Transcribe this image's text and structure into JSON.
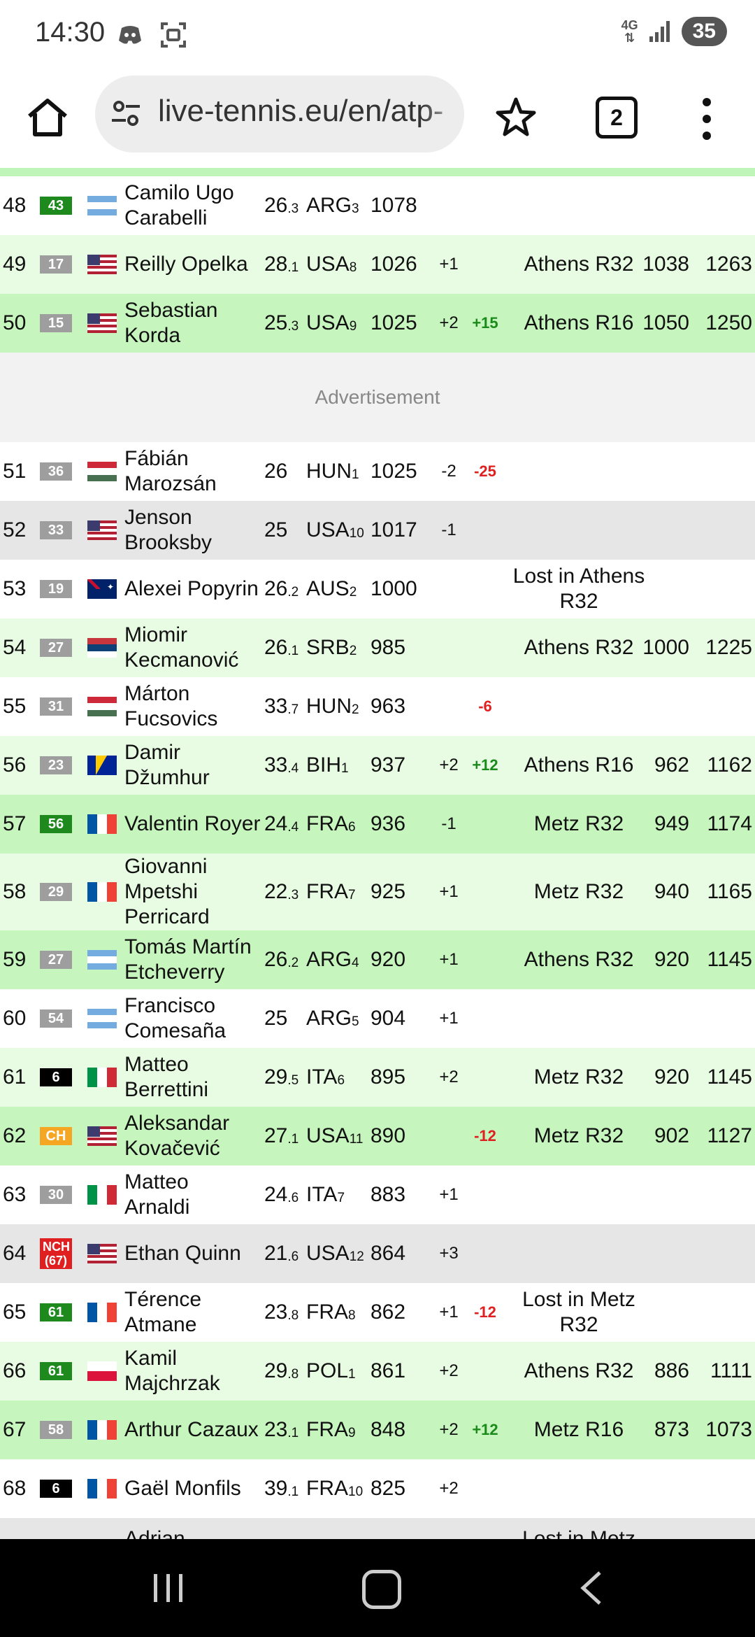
{
  "status_bar": {
    "time": "14:30",
    "left_icons": [
      "discord-icon",
      "screenshot-icon"
    ],
    "network": "4G",
    "battery": "35"
  },
  "browser": {
    "url": "live-tennis.eu/en/atp-",
    "tab_count": "2"
  },
  "ad_label": "Advertisement",
  "rows": [
    {
      "rank": "48",
      "prev": "43",
      "prev_color": "#1e8a1e",
      "flag": "ARG",
      "name": [
        "Camilo Ugo",
        "Carabelli"
      ],
      "age": "26",
      "age_sub": ".3",
      "country": "ARG",
      "country_sub": "3",
      "points": "1078",
      "diff": "",
      "change": "",
      "change_sign": "",
      "tournament": [],
      "max": "",
      "best2": "",
      "bg": "#ffffff"
    },
    {
      "rank": "49",
      "prev": "17",
      "prev_color": "#9e9e9e",
      "flag": "USA",
      "name": [
        "Reilly Opelka"
      ],
      "age": "28",
      "age_sub": ".1",
      "country": "USA",
      "country_sub": "8",
      "points": "1026",
      "diff": "+1",
      "change": "",
      "change_sign": "",
      "tournament": [
        "Athens R32"
      ],
      "max": "1038",
      "best2": "1263",
      "bg": "#e8fbe3"
    },
    {
      "rank": "50",
      "prev": "15",
      "prev_color": "#9e9e9e",
      "flag": "USA",
      "name": [
        "Sebastian",
        "Korda"
      ],
      "age": "25",
      "age_sub": ".3",
      "country": "USA",
      "country_sub": "9",
      "points": "1025",
      "diff": "+2",
      "change": "+15",
      "change_sign": "pos",
      "tournament": [
        "Athens R16"
      ],
      "max": "1050",
      "best2": "1250",
      "bg": "#c6f5be"
    },
    {
      "rank": "51",
      "prev": "36",
      "prev_color": "#9e9e9e",
      "flag": "HUN",
      "name": [
        "Fábián",
        "Marozsán"
      ],
      "age": "26",
      "age_sub": "",
      "country": "HUN",
      "country_sub": "1",
      "points": "1025",
      "diff": "-2",
      "change": "-25",
      "change_sign": "neg",
      "tournament": [],
      "max": "",
      "best2": "",
      "bg": "#ffffff"
    },
    {
      "rank": "52",
      "prev": "33",
      "prev_color": "#9e9e9e",
      "flag": "USA",
      "name": [
        "Jenson",
        "Brooksby"
      ],
      "age": "25",
      "age_sub": "",
      "country": "USA",
      "country_sub": "10",
      "points": "1017",
      "diff": "-1",
      "change": "",
      "change_sign": "",
      "tournament": [],
      "max": "",
      "best2": "",
      "bg": "#e6e6e6"
    },
    {
      "rank": "53",
      "prev": "19",
      "prev_color": "#9e9e9e",
      "flag": "AUS",
      "name": [
        "Alexei Popyrin"
      ],
      "age": "26",
      "age_sub": ".2",
      "country": "AUS",
      "country_sub": "2",
      "points": "1000",
      "diff": "",
      "change": "",
      "change_sign": "",
      "tournament": [
        "Lost in Athens",
        "R32"
      ],
      "max": "",
      "best2": "",
      "bg": "#ffffff"
    },
    {
      "rank": "54",
      "prev": "27",
      "prev_color": "#9e9e9e",
      "flag": "SRB",
      "name": [
        "Miomir",
        "Kecmanović"
      ],
      "age": "26",
      "age_sub": ".1",
      "country": "SRB",
      "country_sub": "2",
      "points": "985",
      "diff": "",
      "change": "",
      "change_sign": "",
      "tournament": [
        "Athens R32"
      ],
      "max": "1000",
      "best2": "1225",
      "bg": "#e8fbe3"
    },
    {
      "rank": "55",
      "prev": "31",
      "prev_color": "#9e9e9e",
      "flag": "HUN",
      "name": [
        "Márton",
        "Fucsovics"
      ],
      "age": "33",
      "age_sub": ".7",
      "country": "HUN",
      "country_sub": "2",
      "points": "963",
      "diff": "",
      "change": "-6",
      "change_sign": "neg",
      "tournament": [],
      "max": "",
      "best2": "",
      "bg": "#ffffff"
    },
    {
      "rank": "56",
      "prev": "23",
      "prev_color": "#9e9e9e",
      "flag": "BIH",
      "name": [
        "Damir",
        "Džumhur"
      ],
      "age": "33",
      "age_sub": ".4",
      "country": "BIH",
      "country_sub": "1",
      "points": "937",
      "diff": "+2",
      "change": "+12",
      "change_sign": "pos",
      "tournament": [
        "Athens R16"
      ],
      "max": "962",
      "best2": "1162",
      "bg": "#e8fbe3"
    },
    {
      "rank": "57",
      "prev": "56",
      "prev_color": "#1e8a1e",
      "flag": "FRA",
      "name": [
        "Valentin Royer"
      ],
      "age": "24",
      "age_sub": ".4",
      "country": "FRA",
      "country_sub": "6",
      "points": "936",
      "diff": "-1",
      "change": "",
      "change_sign": "",
      "tournament": [
        "Metz R32"
      ],
      "max": "949",
      "best2": "1174",
      "bg": "#c6f5be"
    },
    {
      "rank": "58",
      "prev": "29",
      "prev_color": "#9e9e9e",
      "flag": "FRA",
      "name": [
        "Giovanni",
        "Mpetshi",
        "Perricard"
      ],
      "age": "22",
      "age_sub": ".3",
      "country": "FRA",
      "country_sub": "7",
      "points": "925",
      "diff": "+1",
      "change": "",
      "change_sign": "",
      "tournament": [
        "Metz R32"
      ],
      "max": "940",
      "best2": "1165",
      "bg": "#e8fbe3"
    },
    {
      "rank": "59",
      "prev": "27",
      "prev_color": "#9e9e9e",
      "flag": "ARG",
      "name": [
        "Tomás Martín",
        "Etcheverry"
      ],
      "age": "26",
      "age_sub": ".2",
      "country": "ARG",
      "country_sub": "4",
      "points": "920",
      "diff": "+1",
      "change": "",
      "change_sign": "",
      "tournament": [
        "Athens R32"
      ],
      "max": "920",
      "best2": "1145",
      "bg": "#c6f5be"
    },
    {
      "rank": "60",
      "prev": "54",
      "prev_color": "#9e9e9e",
      "flag": "ARG",
      "name": [
        "Francisco",
        "Comesaña"
      ],
      "age": "25",
      "age_sub": "",
      "country": "ARG",
      "country_sub": "5",
      "points": "904",
      "diff": "+1",
      "change": "",
      "change_sign": "",
      "tournament": [],
      "max": "",
      "best2": "",
      "bg": "#ffffff"
    },
    {
      "rank": "61",
      "prev": "6",
      "prev_color": "#000000",
      "flag": "ITA",
      "name": [
        "Matteo",
        "Berrettini"
      ],
      "age": "29",
      "age_sub": ".5",
      "country": "ITA",
      "country_sub": "6",
      "points": "895",
      "diff": "+2",
      "change": "",
      "change_sign": "",
      "tournament": [
        "Metz R32"
      ],
      "max": "920",
      "best2": "1145",
      "bg": "#e8fbe3"
    },
    {
      "rank": "62",
      "prev": "CH",
      "prev_color": "#f5a623",
      "flag": "USA",
      "name": [
        "Aleksandar",
        "Kovačević"
      ],
      "age": "27",
      "age_sub": ".1",
      "country": "USA",
      "country_sub": "11",
      "points": "890",
      "diff": "",
      "change": "-12",
      "change_sign": "neg",
      "tournament": [
        "Metz R32"
      ],
      "max": "902",
      "best2": "1127",
      "bg": "#c6f5be"
    },
    {
      "rank": "63",
      "prev": "30",
      "prev_color": "#9e9e9e",
      "flag": "ITA",
      "name": [
        "Matteo",
        "Arnaldi"
      ],
      "age": "24",
      "age_sub": ".6",
      "country": "ITA",
      "country_sub": "7",
      "points": "883",
      "diff": "+1",
      "change": "",
      "change_sign": "",
      "tournament": [],
      "max": "",
      "best2": "",
      "bg": "#ffffff"
    },
    {
      "rank": "64",
      "prev": "NCH (67)",
      "prev_color": "#e02020",
      "flag": "USA",
      "name": [
        "Ethan Quinn"
      ],
      "age": "21",
      "age_sub": ".6",
      "country": "USA",
      "country_sub": "12",
      "points": "864",
      "diff": "+3",
      "change": "",
      "change_sign": "",
      "tournament": [],
      "max": "",
      "best2": "",
      "bg": "#e6e6e6"
    },
    {
      "rank": "65",
      "prev": "61",
      "prev_color": "#1e8a1e",
      "flag": "FRA",
      "name": [
        "Térence",
        "Atmane"
      ],
      "age": "23",
      "age_sub": ".8",
      "country": "FRA",
      "country_sub": "8",
      "points": "862",
      "diff": "+1",
      "change": "-12",
      "change_sign": "neg",
      "tournament": [
        "Lost in Metz",
        "R32"
      ],
      "max": "",
      "best2": "",
      "bg": "#ffffff"
    },
    {
      "rank": "66",
      "prev": "61",
      "prev_color": "#1e8a1e",
      "flag": "POL",
      "name": [
        "Kamil",
        "Majchrzak"
      ],
      "age": "29",
      "age_sub": ".8",
      "country": "POL",
      "country_sub": "1",
      "points": "861",
      "diff": "+2",
      "change": "",
      "change_sign": "",
      "tournament": [
        "Athens R32"
      ],
      "max": "886",
      "best2": "1111",
      "bg": "#e8fbe3"
    },
    {
      "rank": "67",
      "prev": "58",
      "prev_color": "#9e9e9e",
      "flag": "FRA",
      "name": [
        "Arthur Cazaux"
      ],
      "age": "23",
      "age_sub": ".1",
      "country": "FRA",
      "country_sub": "9",
      "points": "848",
      "diff": "+2",
      "change": "+12",
      "change_sign": "pos",
      "tournament": [
        "Metz R16"
      ],
      "max": "873",
      "best2": "1073",
      "bg": "#c6f5be"
    },
    {
      "rank": "68",
      "prev": "6",
      "prev_color": "#000000",
      "flag": "FRA",
      "name": [
        "Gaël Monfils"
      ],
      "age": "39",
      "age_sub": ".1",
      "country": "FRA",
      "country_sub": "10",
      "points": "825",
      "diff": "+2",
      "change": "",
      "change_sign": "",
      "tournament": [],
      "max": "",
      "best2": "",
      "bg": "#ffffff"
    },
    {
      "rank": "",
      "prev": "",
      "prev_color": "#e6e6e6",
      "flag": "",
      "name": [
        "Adrian"
      ],
      "age": "",
      "age_sub": "",
      "country": "",
      "country_sub": "",
      "points": "",
      "diff": "",
      "change": "",
      "change_sign": "",
      "tournament": [
        "Lost in Metz"
      ],
      "max": "",
      "best2": "",
      "bg": "#e6e6e6"
    }
  ],
  "nav": {
    "buttons": [
      "recents-icon",
      "home-icon",
      "back-icon"
    ]
  }
}
